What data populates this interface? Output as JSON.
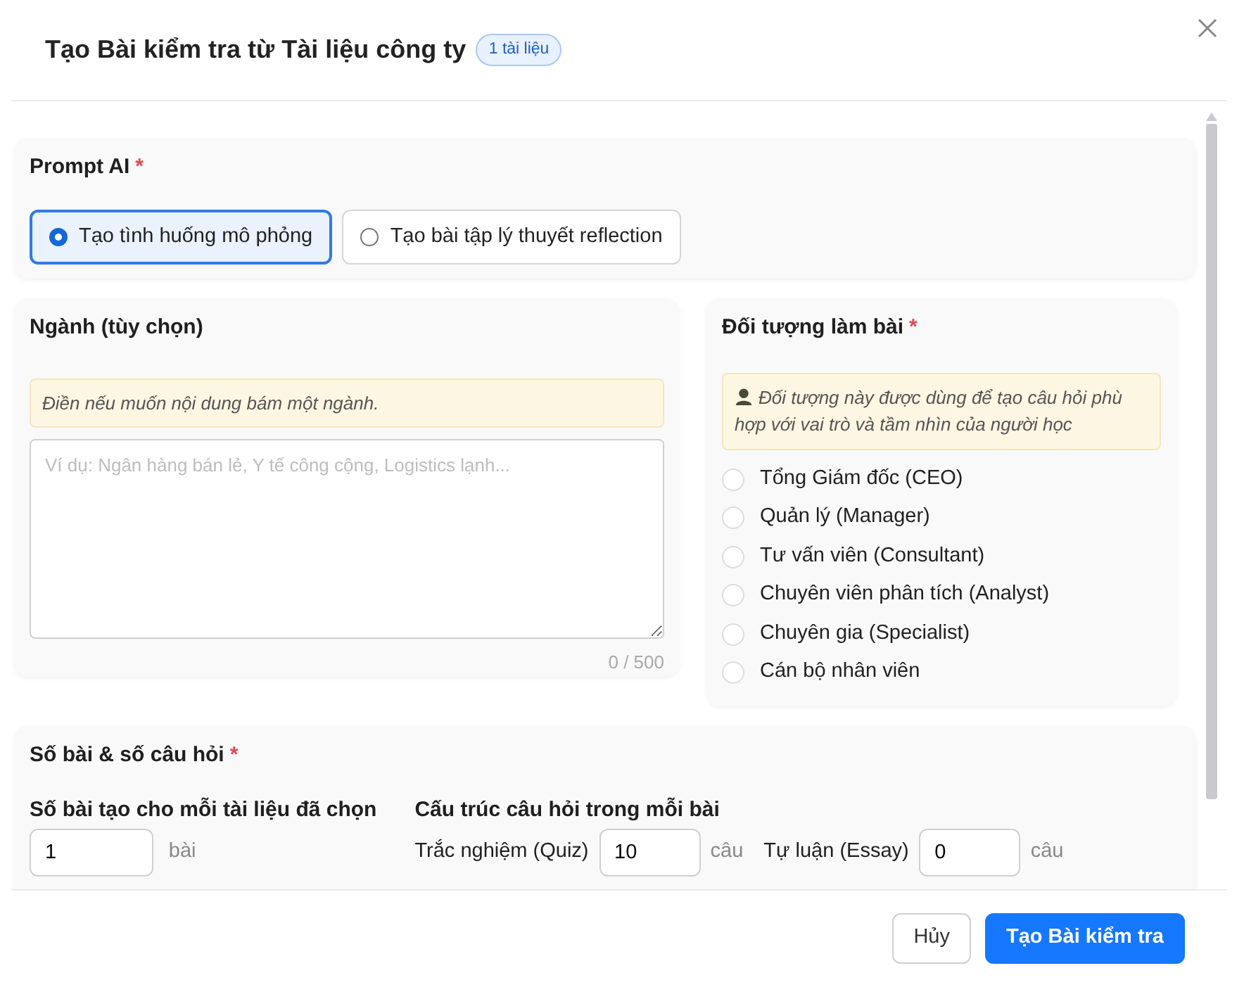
{
  "dialog": {
    "title": "Tạo Bài kiểm tra từ Tài liệu công ty",
    "badge": "1 tài liệu"
  },
  "prompt_section": {
    "title": "Prompt AI",
    "marker": "*",
    "options": [
      {
        "label": "Tạo tình huống mô phỏng",
        "selected": true
      },
      {
        "label": "Tạo bài tập lý thuyết reflection",
        "selected": false
      }
    ]
  },
  "industry_section": {
    "title": "Ngành (tùy chọn)",
    "hint": "Điền nếu muốn nội dung bám một ngành.",
    "placeholder": "Ví dụ: Ngân hàng bán lẻ, Y tế công cộng, Logistics lạnh...",
    "counter": "0 / 500"
  },
  "audience_section": {
    "title": "Đối tượng làm bài",
    "marker": "*",
    "hint": "Đối tượng này được dùng để tạo câu hỏi phù hợp với vai trò và tầm nhìn của người học",
    "options": [
      {
        "label": "Tổng Giám đốc (CEO)",
        "selected": false
      },
      {
        "label": "Quản lý (Manager)",
        "selected": false
      },
      {
        "label": "Tư vấn viên (Consultant)",
        "selected": false
      },
      {
        "label": "Chuyên viên phân tích (Analyst)",
        "selected": false
      },
      {
        "label": "Chuyên gia (Specialist)",
        "selected": false
      },
      {
        "label": "Cán bộ nhân viên",
        "selected": false
      }
    ]
  },
  "count_section": {
    "title": "Số bài & số câu hỏi",
    "marker": "*",
    "per_document": {
      "label": "Số bài tạo cho mỗi tài liệu đã chọn",
      "value": "1",
      "unit": "bài"
    },
    "structure": {
      "label": "Cấu trúc câu hỏi trong mỗi bài",
      "items": [
        {
          "label": "Trắc nghiệm (Quiz)",
          "value": "10",
          "unit": "câu"
        },
        {
          "label": "Tự luận (Essay)",
          "value": "0",
          "unit": "câu"
        }
      ]
    }
  },
  "buttons": [
    {
      "label": "Hủy",
      "kind": "secondary"
    },
    {
      "label": "Tạo Bài kiểm tra",
      "kind": "primary"
    }
  ]
}
